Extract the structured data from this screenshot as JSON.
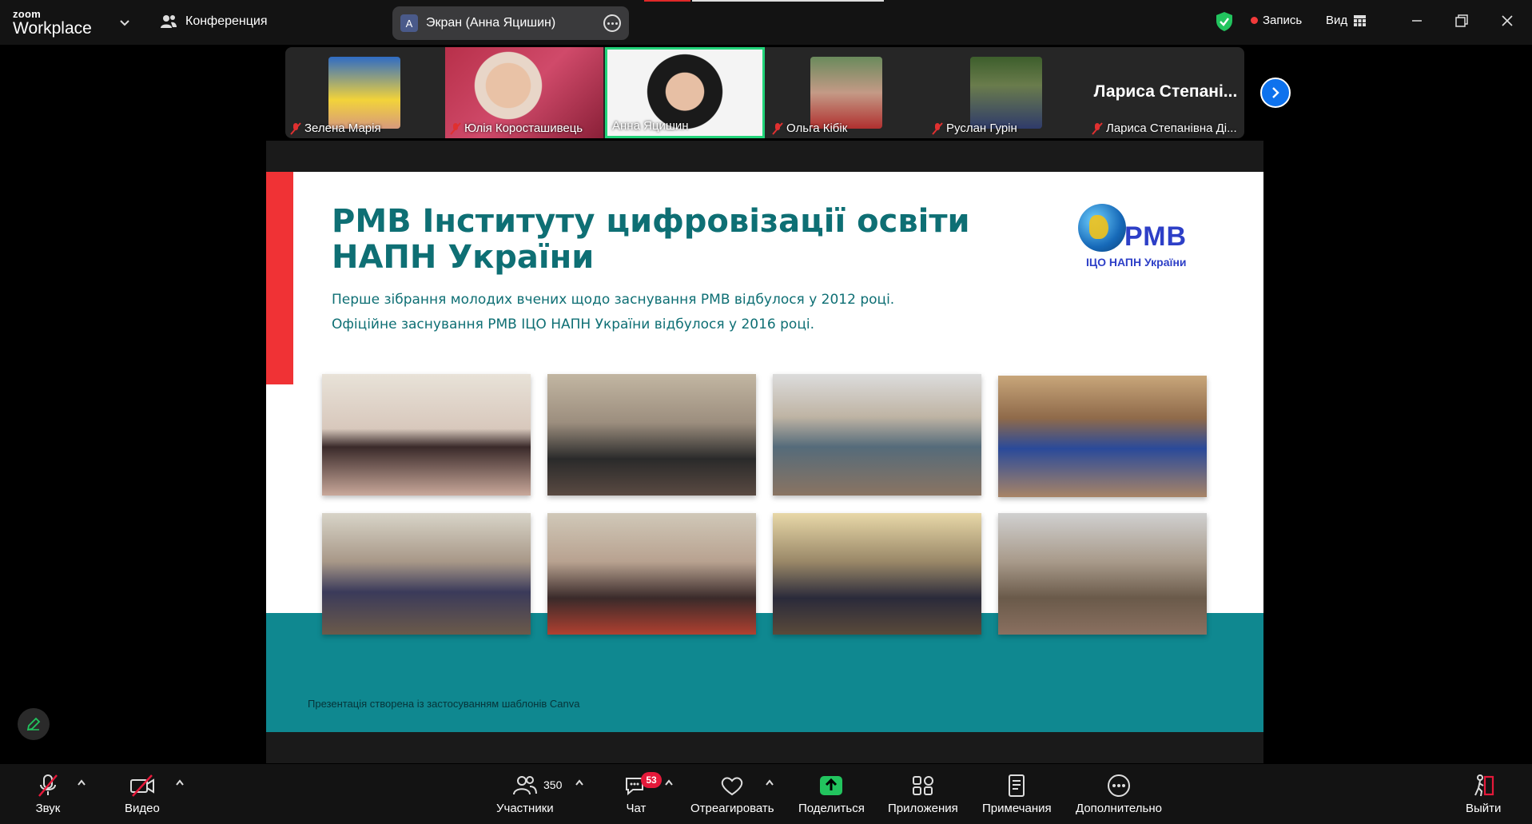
{
  "app": {
    "brand_small": "zoom",
    "brand_large": "Workplace"
  },
  "topbar": {
    "conference_label": "Конференция",
    "share_avatar_letter": "A",
    "share_label": "Экран (Анна Яцишин)",
    "record_label": "Запись",
    "view_label": "Вид"
  },
  "participants": [
    {
      "name": "Зелена Марія",
      "muted": true
    },
    {
      "name": "Юлія Короcташивець",
      "muted": true
    },
    {
      "name": "Анна Яцишин",
      "muted": false,
      "active": true
    },
    {
      "name": "Ольга Кібік",
      "muted": true
    },
    {
      "name": "Руслан Гурін",
      "muted": true
    },
    {
      "name": "Лариса Степанівна Ді...",
      "big_name": "Лариса Степані...",
      "muted": true
    }
  ],
  "slide": {
    "title_line1": "РМВ Інституту цифровізації освіти",
    "title_line2": "НАПН України",
    "sub1": "Перше зібрання молодих вчених щодо заснування РМВ відбулося у 2012 році.",
    "sub2": "Офіційне заснування РМВ ІЦО НАПН України відбулося у 2016 році.",
    "logo_text": "РМВ",
    "logo_sub": "ІЦО НАПН України",
    "footer": "Презентація створена  із застосуванням шаблонів  Canva"
  },
  "toolbar": {
    "audio": "Звук",
    "video": "Видео",
    "participants": "Участники",
    "participants_count": "350",
    "chat": "Чат",
    "chat_badge": "53",
    "react": "Отреагировать",
    "share": "Поделиться",
    "apps": "Приложения",
    "notes": "Примечания",
    "more": "Дополнительно",
    "leave": "Выйти"
  },
  "colors": {
    "slide_title": "#0e6f74",
    "slide_red": "#f03235",
    "slide_teal": "#0f8890",
    "active_speaker": "#22d47a",
    "share_green": "#22c45e",
    "badge_red": "#e5193a",
    "record_red": "#f23a3a"
  }
}
